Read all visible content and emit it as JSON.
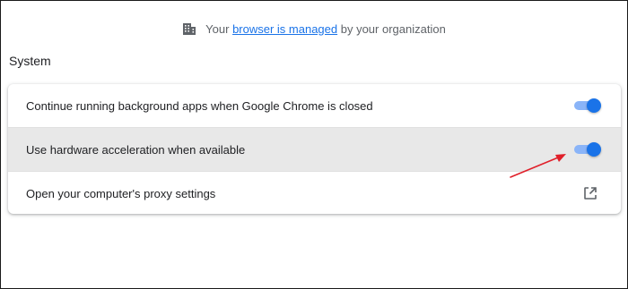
{
  "banner": {
    "prefix": "Your ",
    "link": "browser is managed",
    "suffix": " by your organization",
    "icon": "building-icon"
  },
  "section": {
    "title": "System"
  },
  "settings": {
    "items": [
      {
        "label": "Continue running background apps when Google Chrome is closed",
        "control": "toggle",
        "state": "on"
      },
      {
        "label": "Use hardware acceleration when available",
        "control": "toggle",
        "state": "on"
      },
      {
        "label": "Open your computer's proxy settings",
        "control": "open-in-new-icon"
      }
    ]
  },
  "colors": {
    "toggle_on": "#1a73e8",
    "toggle_track": "#8ab4f8",
    "highlight_row": "#e8e8e8",
    "annotation_arrow": "#e0202a",
    "link": "#1a73e8"
  }
}
